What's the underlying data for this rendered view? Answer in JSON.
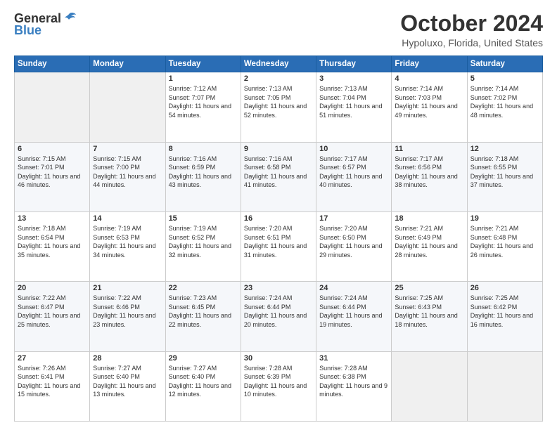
{
  "header": {
    "logo_general": "General",
    "logo_blue": "Blue",
    "month_title": "October 2024",
    "location": "Hypoluxo, Florida, United States"
  },
  "days_of_week": [
    "Sunday",
    "Monday",
    "Tuesday",
    "Wednesday",
    "Thursday",
    "Friday",
    "Saturday"
  ],
  "weeks": [
    [
      {
        "day": "",
        "info": ""
      },
      {
        "day": "",
        "info": ""
      },
      {
        "day": "1",
        "info": "Sunrise: 7:12 AM\nSunset: 7:07 PM\nDaylight: 11 hours and 54 minutes."
      },
      {
        "day": "2",
        "info": "Sunrise: 7:13 AM\nSunset: 7:05 PM\nDaylight: 11 hours and 52 minutes."
      },
      {
        "day": "3",
        "info": "Sunrise: 7:13 AM\nSunset: 7:04 PM\nDaylight: 11 hours and 51 minutes."
      },
      {
        "day": "4",
        "info": "Sunrise: 7:14 AM\nSunset: 7:03 PM\nDaylight: 11 hours and 49 minutes."
      },
      {
        "day": "5",
        "info": "Sunrise: 7:14 AM\nSunset: 7:02 PM\nDaylight: 11 hours and 48 minutes."
      }
    ],
    [
      {
        "day": "6",
        "info": "Sunrise: 7:15 AM\nSunset: 7:01 PM\nDaylight: 11 hours and 46 minutes."
      },
      {
        "day": "7",
        "info": "Sunrise: 7:15 AM\nSunset: 7:00 PM\nDaylight: 11 hours and 44 minutes."
      },
      {
        "day": "8",
        "info": "Sunrise: 7:16 AM\nSunset: 6:59 PM\nDaylight: 11 hours and 43 minutes."
      },
      {
        "day": "9",
        "info": "Sunrise: 7:16 AM\nSunset: 6:58 PM\nDaylight: 11 hours and 41 minutes."
      },
      {
        "day": "10",
        "info": "Sunrise: 7:17 AM\nSunset: 6:57 PM\nDaylight: 11 hours and 40 minutes."
      },
      {
        "day": "11",
        "info": "Sunrise: 7:17 AM\nSunset: 6:56 PM\nDaylight: 11 hours and 38 minutes."
      },
      {
        "day": "12",
        "info": "Sunrise: 7:18 AM\nSunset: 6:55 PM\nDaylight: 11 hours and 37 minutes."
      }
    ],
    [
      {
        "day": "13",
        "info": "Sunrise: 7:18 AM\nSunset: 6:54 PM\nDaylight: 11 hours and 35 minutes."
      },
      {
        "day": "14",
        "info": "Sunrise: 7:19 AM\nSunset: 6:53 PM\nDaylight: 11 hours and 34 minutes."
      },
      {
        "day": "15",
        "info": "Sunrise: 7:19 AM\nSunset: 6:52 PM\nDaylight: 11 hours and 32 minutes."
      },
      {
        "day": "16",
        "info": "Sunrise: 7:20 AM\nSunset: 6:51 PM\nDaylight: 11 hours and 31 minutes."
      },
      {
        "day": "17",
        "info": "Sunrise: 7:20 AM\nSunset: 6:50 PM\nDaylight: 11 hours and 29 minutes."
      },
      {
        "day": "18",
        "info": "Sunrise: 7:21 AM\nSunset: 6:49 PM\nDaylight: 11 hours and 28 minutes."
      },
      {
        "day": "19",
        "info": "Sunrise: 7:21 AM\nSunset: 6:48 PM\nDaylight: 11 hours and 26 minutes."
      }
    ],
    [
      {
        "day": "20",
        "info": "Sunrise: 7:22 AM\nSunset: 6:47 PM\nDaylight: 11 hours and 25 minutes."
      },
      {
        "day": "21",
        "info": "Sunrise: 7:22 AM\nSunset: 6:46 PM\nDaylight: 11 hours and 23 minutes."
      },
      {
        "day": "22",
        "info": "Sunrise: 7:23 AM\nSunset: 6:45 PM\nDaylight: 11 hours and 22 minutes."
      },
      {
        "day": "23",
        "info": "Sunrise: 7:24 AM\nSunset: 6:44 PM\nDaylight: 11 hours and 20 minutes."
      },
      {
        "day": "24",
        "info": "Sunrise: 7:24 AM\nSunset: 6:44 PM\nDaylight: 11 hours and 19 minutes."
      },
      {
        "day": "25",
        "info": "Sunrise: 7:25 AM\nSunset: 6:43 PM\nDaylight: 11 hours and 18 minutes."
      },
      {
        "day": "26",
        "info": "Sunrise: 7:25 AM\nSunset: 6:42 PM\nDaylight: 11 hours and 16 minutes."
      }
    ],
    [
      {
        "day": "27",
        "info": "Sunrise: 7:26 AM\nSunset: 6:41 PM\nDaylight: 11 hours and 15 minutes."
      },
      {
        "day": "28",
        "info": "Sunrise: 7:27 AM\nSunset: 6:40 PM\nDaylight: 11 hours and 13 minutes."
      },
      {
        "day": "29",
        "info": "Sunrise: 7:27 AM\nSunset: 6:40 PM\nDaylight: 11 hours and 12 minutes."
      },
      {
        "day": "30",
        "info": "Sunrise: 7:28 AM\nSunset: 6:39 PM\nDaylight: 11 hours and 10 minutes."
      },
      {
        "day": "31",
        "info": "Sunrise: 7:28 AM\nSunset: 6:38 PM\nDaylight: 11 hours and 9 minutes."
      },
      {
        "day": "",
        "info": ""
      },
      {
        "day": "",
        "info": ""
      }
    ]
  ]
}
